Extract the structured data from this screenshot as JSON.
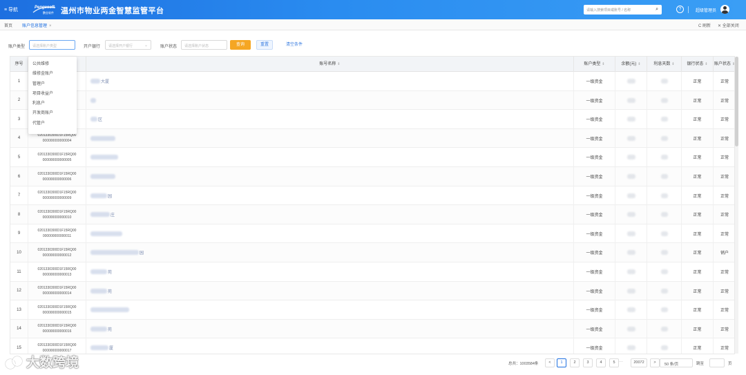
{
  "header": {
    "menu_label": "≡ 导航",
    "logo_text": "Pengesoft",
    "logo_sub": "鹏业软件",
    "title": "温州市物业两金智慧监管平台",
    "search_placeholder": "请输入搜索项目或账号 / 名称",
    "search_icon": "search-icon",
    "help_icon": "help-icon",
    "user_name": "超级管理员",
    "brand_color": "#1d6fe0"
  },
  "tabs": {
    "home": "首页",
    "active": "账户信息管理",
    "active_close": "×",
    "refresh": "C 刷新",
    "close_all": "✕ 全部关闭"
  },
  "filters": {
    "acct_type_label": "账户类型",
    "acct_type_placeholder": "请选择账户类型",
    "bank_label": "开户银行",
    "bank_placeholder": "请选择开户银行",
    "acct_no_label": "账户状态",
    "acct_no_placeholder": "请选择账户状态",
    "query_btn": "查询",
    "reset_btn": "重置",
    "clear_btn": "清空条件"
  },
  "dropdown": {
    "items": [
      "公共维修",
      "维修金账户",
      "管理户",
      "项目收益户",
      "利息户",
      "开发商账户",
      "代管户"
    ]
  },
  "table": {
    "columns": {
      "no": "序号",
      "account": "账号名称",
      "type": "账户类型",
      "balance": "余额(元)",
      "interest": "利息天数",
      "bank_status": "银行状态",
      "acct_status": "账户状态"
    },
    "sort_icon": "sort-icon",
    "rows": [
      {
        "no": "1",
        "acct1": "",
        "acct2": "",
        "tail": "大厦",
        "type": "一级资金",
        "bstat": "正常",
        "astat": "正常"
      },
      {
        "no": "2",
        "acct1": "",
        "acct2": "",
        "tail": "",
        "type": "一级资金",
        "bstat": "正常",
        "astat": "正常"
      },
      {
        "no": "3",
        "acct1": "",
        "acct2": "",
        "tail": "区",
        "type": "一级资金",
        "bstat": "正常",
        "astat": "正常"
      },
      {
        "no": "4",
        "acct1": "0201330300D1F15RQ00",
        "acct2": "000000000000004",
        "tail": "",
        "type": "一级资金",
        "bstat": "正常",
        "astat": "正常"
      },
      {
        "no": "5",
        "acct1": "0201330300D1F15RQ00",
        "acct2": "000000000000005",
        "tail": "",
        "type": "一级资金",
        "bstat": "正常",
        "astat": "正常"
      },
      {
        "no": "6",
        "acct1": "0201330300D1F15RQ00",
        "acct2": "000000000000006",
        "tail": "",
        "type": "一级资金",
        "bstat": "正常",
        "astat": "正常"
      },
      {
        "no": "7",
        "acct1": "0201330300D1F15RQ00",
        "acct2": "000000000000009",
        "tail": "园",
        "type": "一级资金",
        "bstat": "正常",
        "astat": "正常"
      },
      {
        "no": "8",
        "acct1": "0201330300D1F15RQ00",
        "acct2": "000000000000010",
        "tail": "庄",
        "type": "一级资金",
        "bstat": "正常",
        "astat": "正常"
      },
      {
        "no": "9",
        "acct1": "0201330300D1F15RQ00",
        "acct2": "000000000000011",
        "tail": "",
        "type": "一级资金",
        "bstat": "正常",
        "astat": "正常"
      },
      {
        "no": "10",
        "acct1": "0201330300D1F15RQ00",
        "acct2": "000000000000012",
        "tail": "园",
        "type": "一级资金",
        "bstat": "正常",
        "astat": "销户"
      },
      {
        "no": "11",
        "acct1": "0201330300D1F15RQ00",
        "acct2": "000000000000013",
        "tail": "苑",
        "type": "一级资金",
        "bstat": "正常",
        "astat": "正常"
      },
      {
        "no": "12",
        "acct1": "0201330300D1F15RQ00",
        "acct2": "000000000000014",
        "tail": "苑",
        "type": "一级资金",
        "bstat": "正常",
        "astat": "正常"
      },
      {
        "no": "13",
        "acct1": "0201330300D1F15RQ00",
        "acct2": "000000000000015",
        "tail": "",
        "type": "一级资金",
        "bstat": "正常",
        "astat": "正常"
      },
      {
        "no": "14",
        "acct1": "0201330300D1F15RQ00",
        "acct2": "000000000000016",
        "tail": "苑",
        "type": "一级资金",
        "bstat": "正常",
        "astat": "正常"
      },
      {
        "no": "15",
        "acct1": "0201330300D1F15RQ00",
        "acct2": "000000000000017",
        "tail": "厦",
        "type": "一级资金",
        "bstat": "正常",
        "astat": "正常"
      }
    ]
  },
  "pager": {
    "total": "总共：1003584条",
    "prev": "<",
    "pages": [
      "1",
      "2",
      "3",
      "4",
      "5"
    ],
    "active_page": "1",
    "ellipsis": "···",
    "last": "20072",
    "next": ">",
    "page_size": "50 条/页",
    "goto": "跳至",
    "page_unit": "页"
  },
  "watermark": {
    "text": "大数跨境"
  }
}
